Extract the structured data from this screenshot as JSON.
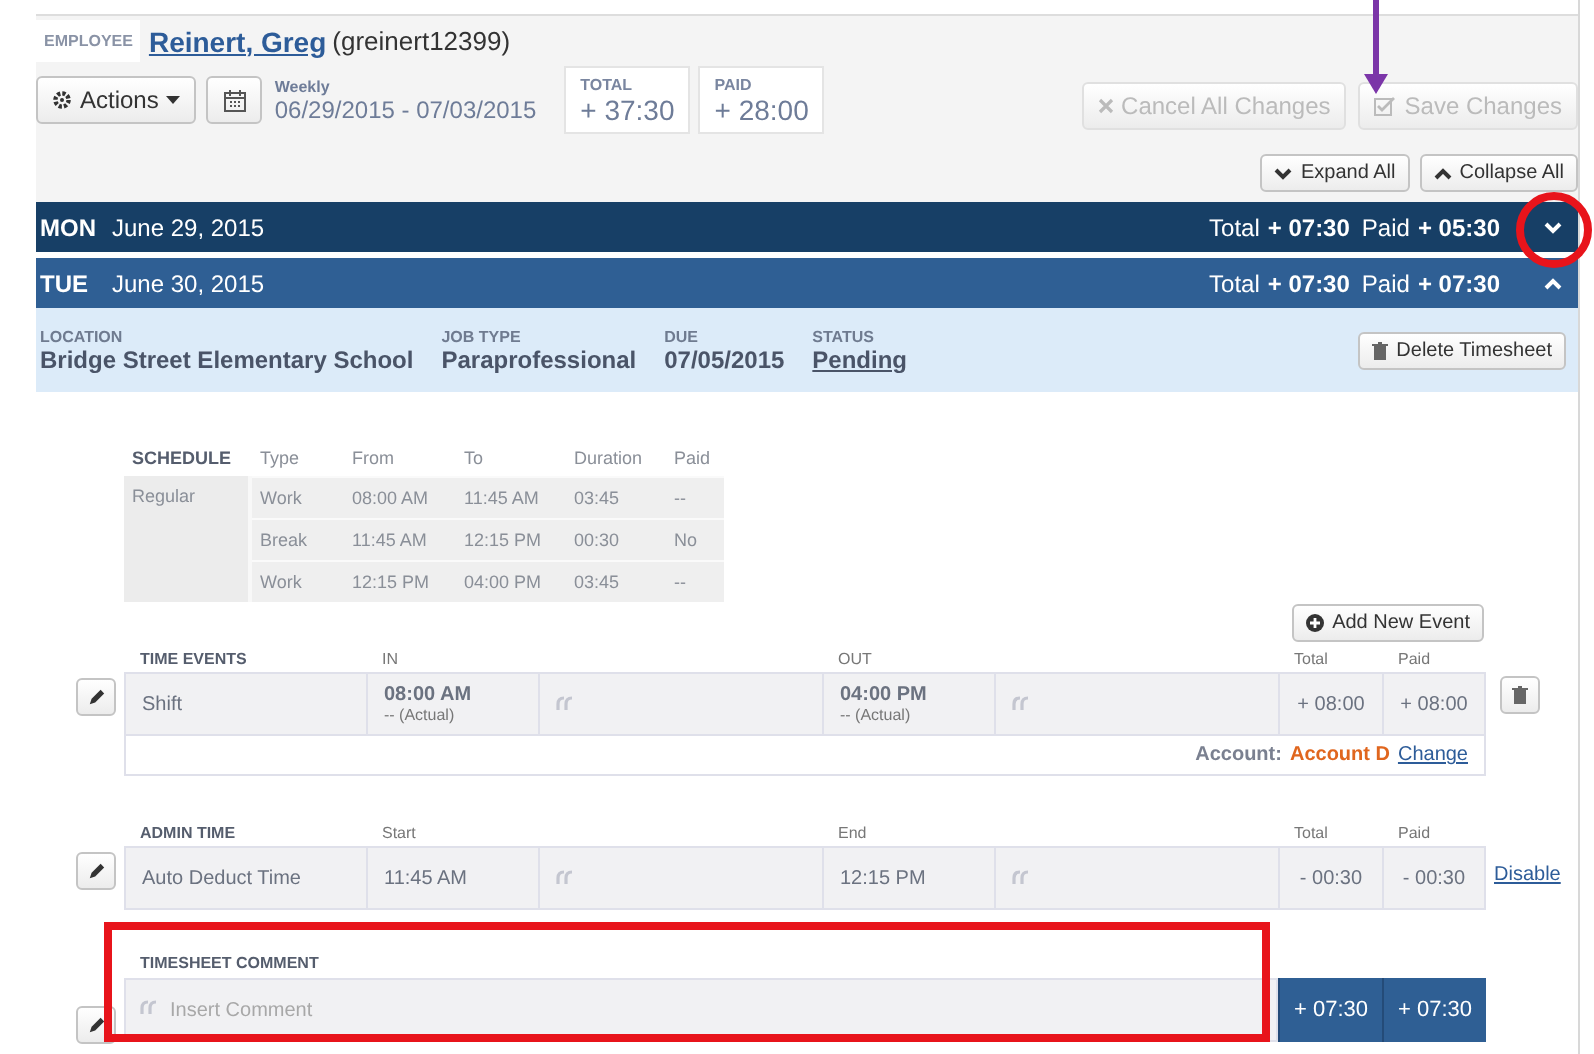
{
  "employee": {
    "label": "EMPLOYEE",
    "name": "Reinert, Greg",
    "username": "(greinert12399)"
  },
  "toolbar": {
    "actions": "Actions",
    "period_label": "Weekly",
    "period": "06/29/2015 - 07/03/2015",
    "totals": [
      {
        "label": "TOTAL",
        "value": "+ 37:30"
      },
      {
        "label": "PAID",
        "value": "+ 28:00"
      }
    ],
    "buttons": [
      {
        "kind": "cancel",
        "label": "Cancel All Changes",
        "disabled": true
      },
      {
        "kind": "save",
        "label": "Save Changes",
        "disabled": true
      }
    ]
  },
  "view_buttons": [
    {
      "kind": "expand",
      "label": "Expand All"
    },
    {
      "kind": "collapse",
      "label": "Collapse All"
    }
  ],
  "days": [
    {
      "weekday": "MON",
      "date": "June 29, 2015",
      "total_label": "Total",
      "total": "+ 07:30",
      "paid_label": "Paid",
      "paid": "+ 05:30",
      "expanded": false
    },
    {
      "weekday": "TUE",
      "date": "June 30, 2015",
      "total_label": "Total",
      "total": "+ 07:30",
      "paid_label": "Paid",
      "paid": "+ 07:30",
      "expanded": true
    }
  ],
  "timesheet": {
    "fields": [
      {
        "label": "LOCATION",
        "value": "Bridge Street Elementary School",
        "kind": "text"
      },
      {
        "label": "JOB TYPE",
        "value": "Paraprofessional",
        "kind": "text"
      },
      {
        "label": "DUE",
        "value": "07/05/2015",
        "kind": "text"
      },
      {
        "label": "STATUS",
        "value": "Pending",
        "kind": "link"
      }
    ],
    "delete": "Delete Timesheet"
  },
  "schedule": {
    "title": "SCHEDULE",
    "columns": [
      "Type",
      "From",
      "To",
      "Duration",
      "Paid"
    ],
    "name": "Regular",
    "rows": [
      [
        "Work",
        "08:00 AM",
        "11:45 AM",
        "03:45",
        "--"
      ],
      [
        "Break",
        "11:45 AM",
        "12:15 PM",
        "00:30",
        "No"
      ],
      [
        "Work",
        "12:15 PM",
        "04:00 PM",
        "03:45",
        "--"
      ]
    ]
  },
  "add_event": "Add New Event",
  "time_events": {
    "title": "TIME EVENTS",
    "columns": [
      "IN",
      "OUT",
      "Total",
      "Paid"
    ],
    "rows": [
      {
        "name": "Shift",
        "in": "08:00 AM",
        "in_note": "-- (Actual)",
        "out": "04:00 PM",
        "out_note": "-- (Actual)",
        "total": "+ 08:00",
        "paid": "+ 08:00"
      }
    ],
    "account_label": "Account:",
    "account": "Account D",
    "change": "Change"
  },
  "admin_time": {
    "title": "ADMIN TIME",
    "columns": [
      "Start",
      "End",
      "Total",
      "Paid"
    ],
    "rows": [
      {
        "name": "Auto Deduct Time",
        "start": "11:45 AM",
        "end": "12:15 PM",
        "total": "- 00:30",
        "paid": "- 00:30",
        "action": "Disable"
      }
    ]
  },
  "comment": {
    "title": "TIMESHEET COMMENT",
    "placeholder": "Insert Comment",
    "total": "+ 07:30",
    "paid": "+ 07:30"
  }
}
